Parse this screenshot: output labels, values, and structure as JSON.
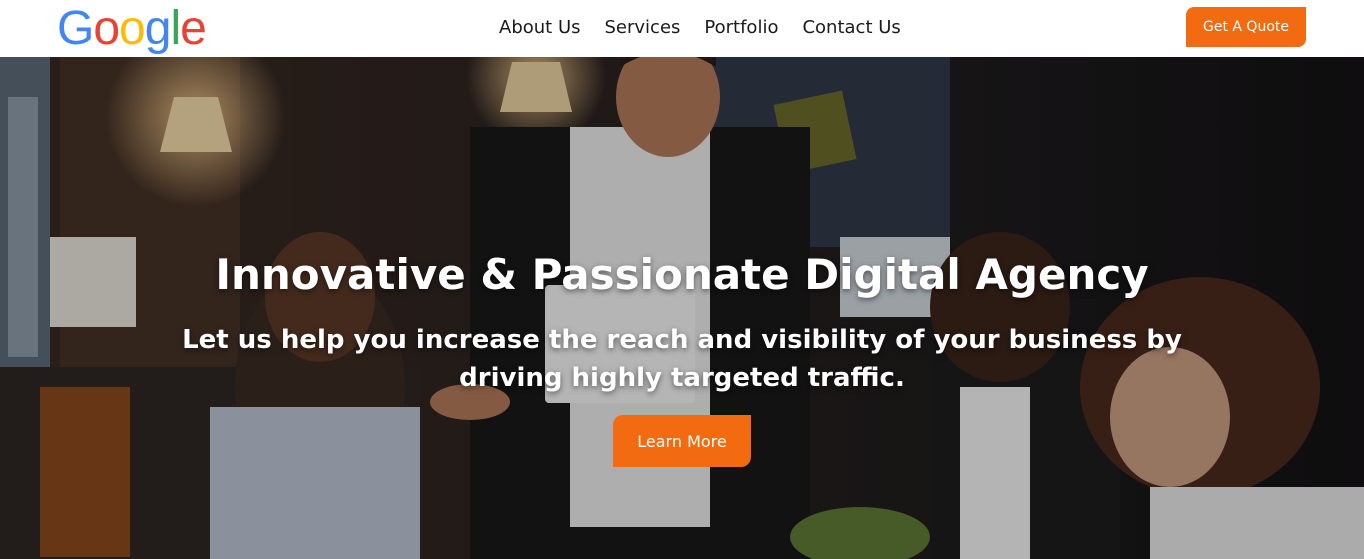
{
  "brand": {
    "logo_letters": [
      "G",
      "o",
      "o",
      "g",
      "l",
      "e"
    ],
    "logo_colors": [
      "#4285F4",
      "#EA4335",
      "#FBBC05",
      "#4285F4",
      "#34A853",
      "#EA4335"
    ]
  },
  "nav": {
    "items": [
      {
        "label": "About Us"
      },
      {
        "label": "Services"
      },
      {
        "label": "Portfolio"
      },
      {
        "label": "Contact Us"
      }
    ],
    "cta_label": "Get A Quote"
  },
  "hero": {
    "title": "Innovative & Passionate Digital Agency",
    "subtitle": "Let us help you increase the reach and visibility of your business by driving highly targeted traffic.",
    "button_label": "Learn More"
  },
  "colors": {
    "accent": "#F26B10",
    "nav_text": "#1A1A1A",
    "hero_text": "#FFFFFF"
  }
}
